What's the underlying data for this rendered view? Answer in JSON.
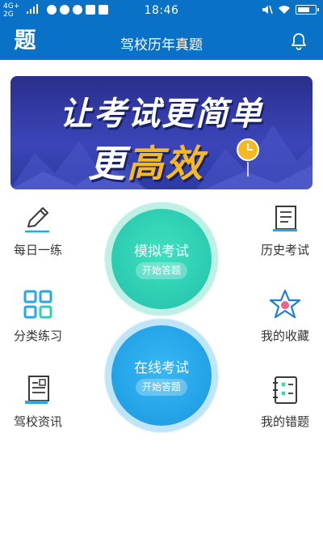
{
  "status_bar": {
    "network_top": "4G+",
    "network_bottom": "2G",
    "time": "18:46"
  },
  "header": {
    "logo_text": "题",
    "title": "驾校历年真题",
    "bell_icon": "bell-icon"
  },
  "banner": {
    "line1": "让考试更简单",
    "line2_white": "更",
    "line2_yellow": "高效",
    "colors": {
      "background": "#2e3aa6",
      "accent": "#f6b922"
    }
  },
  "menu": {
    "daily_practice": "每日一练",
    "history_exam": "历史考试",
    "category_practice": "分类练习",
    "my_favorites": "我的收藏",
    "school_news": "驾校资讯",
    "my_mistakes": "我的错题"
  },
  "buttons": {
    "mock_exam": {
      "title": "模拟考试",
      "action": "开始答题",
      "color": "#2fcfb4"
    },
    "online_exam": {
      "title": "在线考试",
      "action": "开始答题",
      "color": "#27a6ea"
    }
  },
  "theme": {
    "primary": "#0a72c6"
  }
}
